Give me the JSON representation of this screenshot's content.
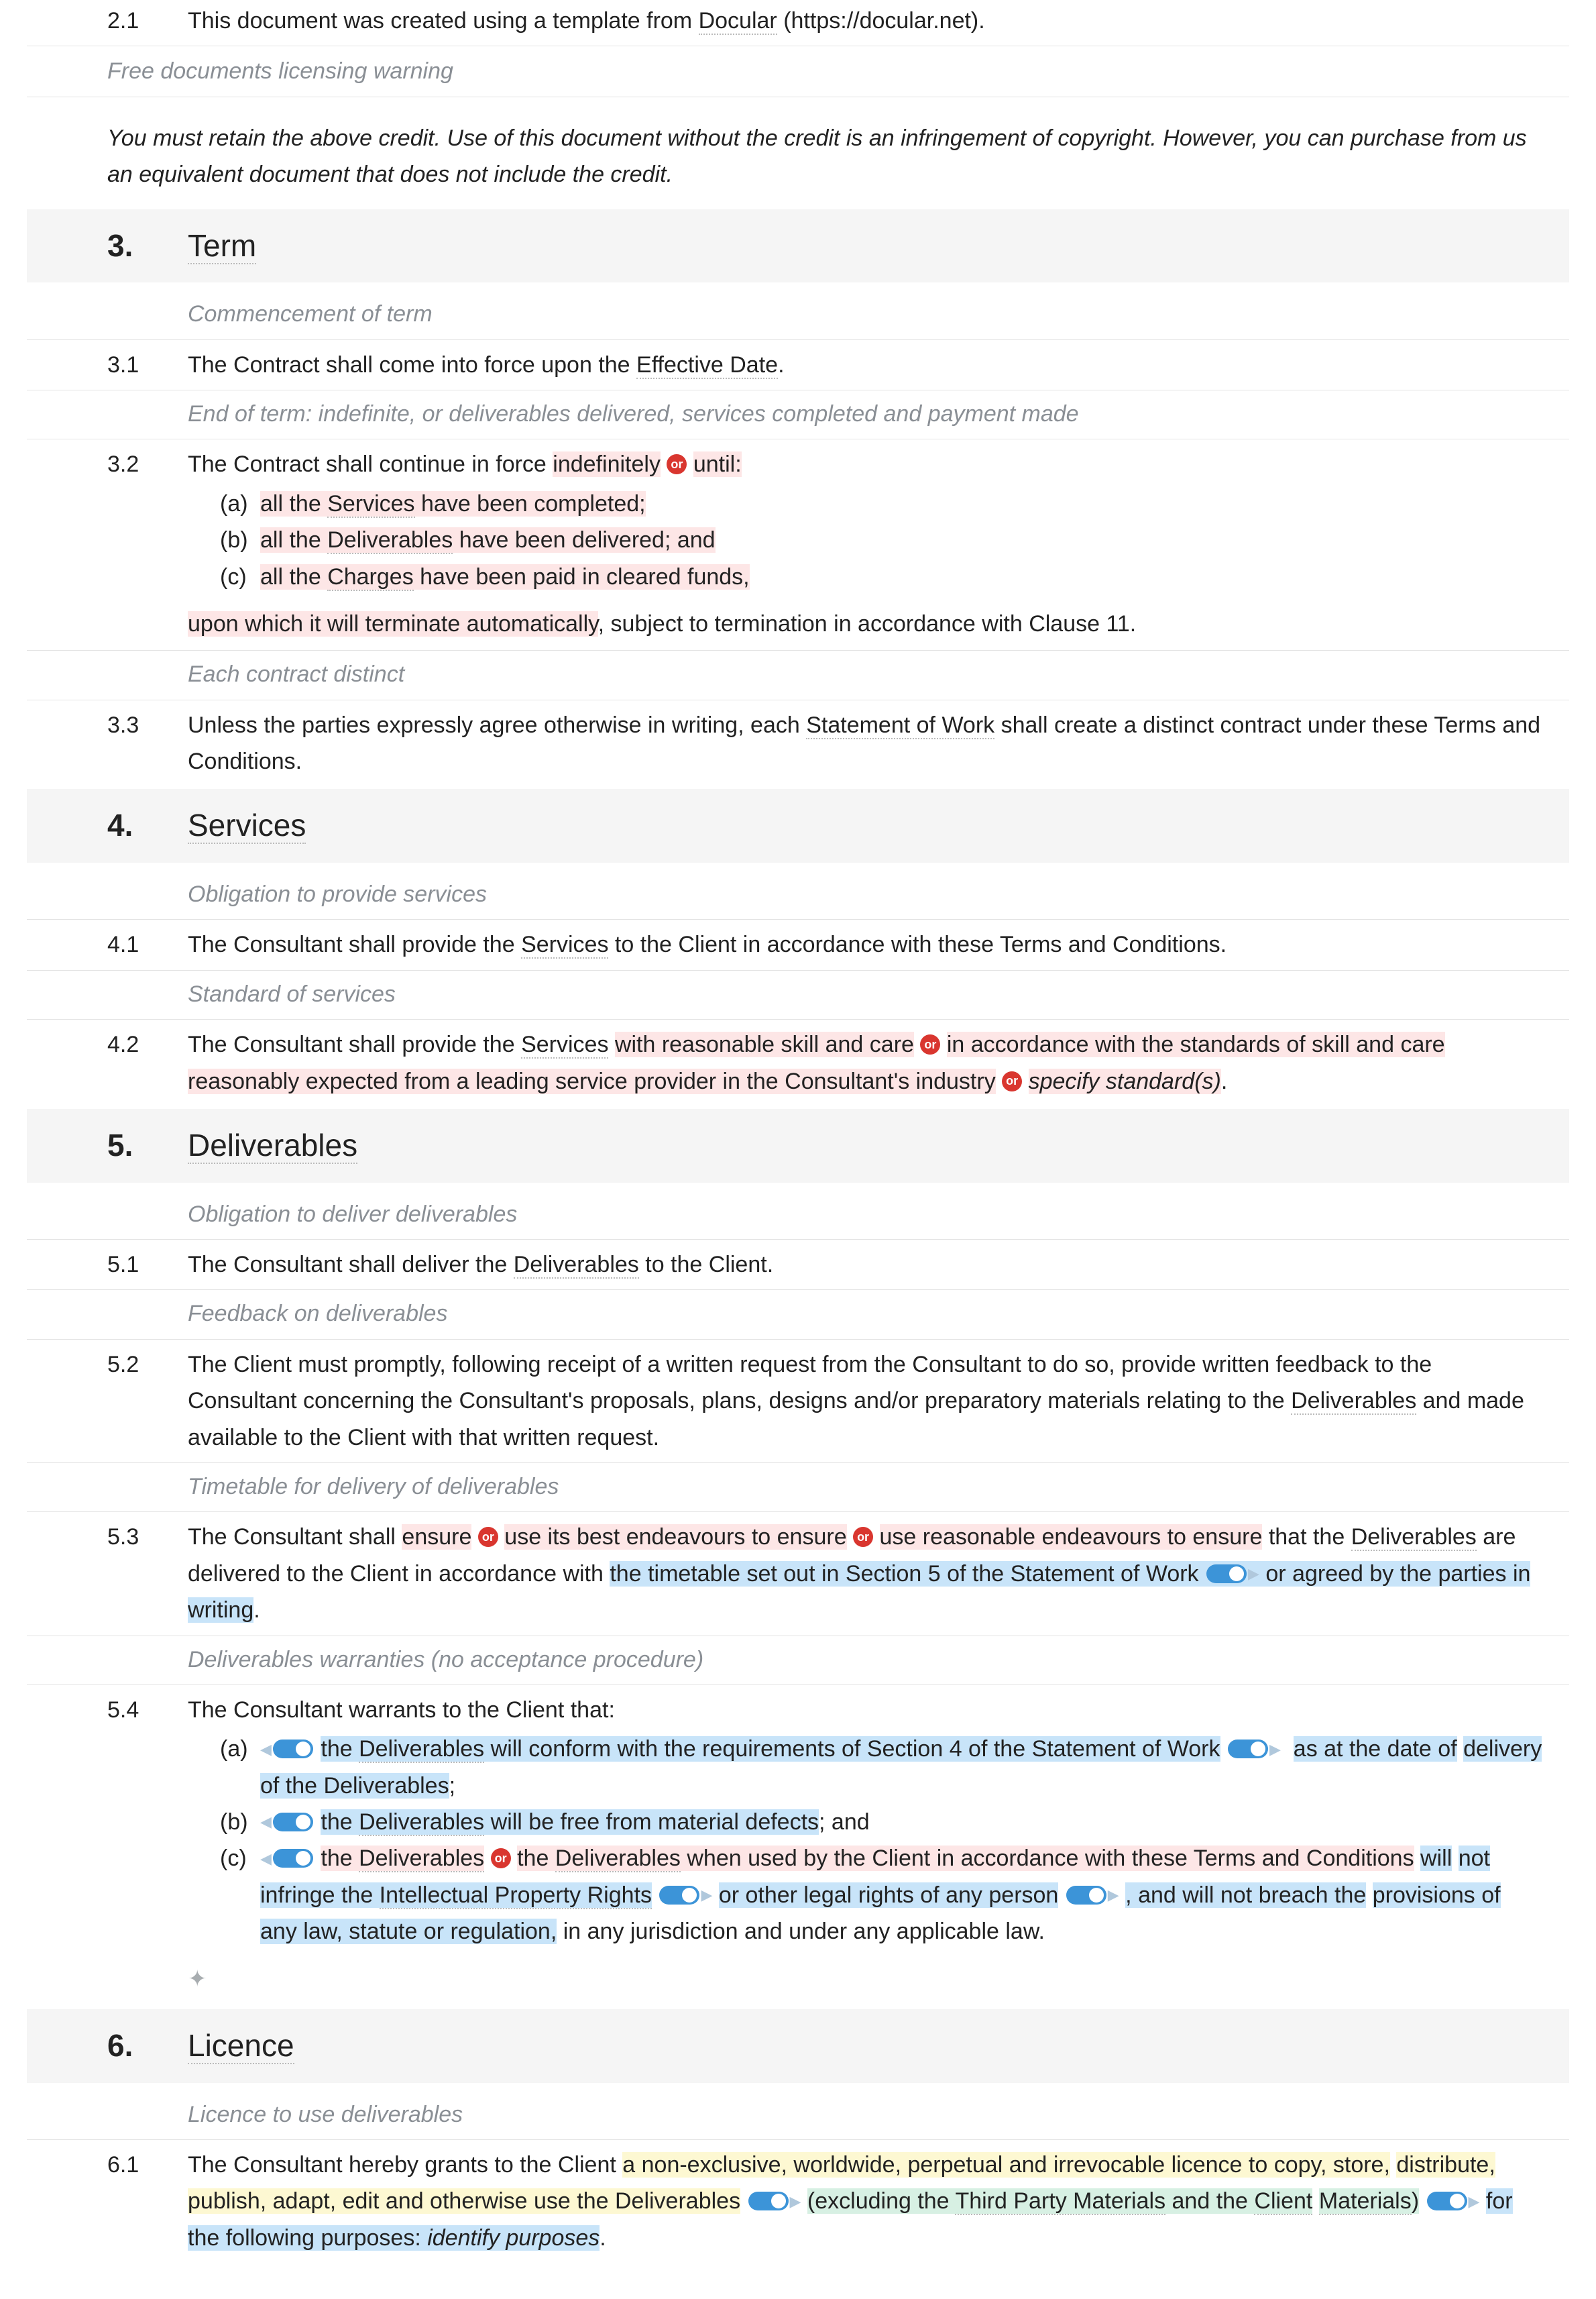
{
  "clause_2_1": {
    "num": "2.1",
    "text_before": "This document was created using a template from ",
    "dotted": "Docular",
    "text_after": " (https://docular.net)."
  },
  "warning_heading": "Free documents licensing warning",
  "warning_text": "You must retain the above credit. Use of this document without the credit is an infringement of copyright. However, you can purchase from us an equivalent document that does not include the credit.",
  "section3": {
    "num": "3.",
    "title": "Term"
  },
  "note_commencement": "Commencement of term",
  "clause_3_1": {
    "num": "3.1",
    "pre": "The Contract shall come into force upon the ",
    "dotted": "Effective Date",
    "post": "."
  },
  "note_end_of_term": "End of term: indefinite, or deliverables delivered, services completed and payment made",
  "clause_3_2": {
    "num": "3.2",
    "intro_a": "The Contract shall continue in force ",
    "hl1": "indefinitely",
    "or": "or",
    "hl2": "until:",
    "a_mark": "(a)",
    "a_pre": "all the ",
    "a_dot": "Services",
    "a_post": " have been completed;",
    "b_mark": "(b)",
    "b_pre": "all the ",
    "b_dot": "Deliverables",
    "b_post": " have been delivered; and",
    "c_mark": "(c)",
    "c_pre": "all the ",
    "c_dot": "Charges",
    "c_post": " have been paid in cleared funds,",
    "tail_hl": "upon which it will terminate automatically",
    "tail_rest": ", subject to termination in accordance with Clause 11."
  },
  "note_each_distinct": "Each contract distinct",
  "clause_3_3": {
    "num": "3.3",
    "pre": "Unless the parties expressly agree otherwise in writing, each ",
    "dotted": "Statement of Work",
    "post": " shall create a distinct contract under these Terms and Conditions."
  },
  "section4": {
    "num": "4.",
    "title": "Services"
  },
  "note_oblig_services": "Obligation to provide services",
  "clause_4_1": {
    "num": "4.1",
    "pre": "The Consultant shall provide the ",
    "dotted": "Services",
    "post": " to the Client in accordance with these Terms and Conditions."
  },
  "note_standard": "Standard of services",
  "clause_4_2": {
    "num": "4.2",
    "a": "The Consultant shall provide the ",
    "dot": "Services",
    "sp": " ",
    "hl1": "with reasonable skill and care",
    "hl2": "in accordance with the standards of skill and care reasonably expected from a leading service provider in the Consultant's industry",
    "hl3": "specify standard(s)",
    "period": "."
  },
  "section5": {
    "num": "5.",
    "title": "Deliverables"
  },
  "note_oblig_deliver": "Obligation to deliver deliverables",
  "clause_5_1": {
    "num": "5.1",
    "pre": "The Consultant shall deliver the ",
    "dotted": "Deliverables",
    "post": " to the Client."
  },
  "note_feedback": "Feedback on deliverables",
  "clause_5_2": {
    "num": "5.2",
    "pre": "The Client must promptly, following receipt of a written request from the Consultant to do so, provide written feedback to the Consultant concerning the Consultant's proposals, plans, designs and/or preparatory materials relating to the ",
    "dotted": "Deliverables",
    "post": " and made available to the Client with that written request."
  },
  "note_timetable": "Timetable for delivery of deliverables",
  "clause_5_3": {
    "num": "5.3",
    "a": "The Consultant shall ",
    "hl1": "ensure",
    "hl2": "use its best endeavours to ensure",
    "hl3": "use reasonable endeavours to ensure",
    "b": " that the ",
    "dot": "Deliverables",
    "c": " are delivered to the Client in accordance with ",
    "bl1": "the timetable set out in Section 5 of the Statement of Work",
    "bl2a": "or",
    "bl2b": "agreed by the parties in writing",
    "period": "."
  },
  "note_warranties": "Deliverables warranties (no acceptance procedure)",
  "clause_5_4": {
    "num": "5.4",
    "intro": "The Consultant warrants to the Client that:",
    "a_mark": "(a)",
    "a_pre": "the ",
    "a_dot": "Deliverables",
    "a_mid": " will conform with the requirements of Section 4 of the Statement of Work",
    "a_tail_pre": "as at the date of",
    "a_tail_rest": "delivery of the Deliverables",
    "a_semi": ";",
    "b_mark": "(b)",
    "b_pre": "the ",
    "b_dot": "Deliverables",
    "b_post": " will be free from material defects",
    "b_after": "; and",
    "c_mark": "(c)",
    "c_hl1_pre": "the ",
    "c_hl1_dot": "Deliverables",
    "c_hl2_pre": "the ",
    "c_hl2_dot": "Deliverables",
    "c_hl2_post": " when used by the Client in accordance with these Terms and Conditions",
    "c_mid1_pre": "will",
    "c_mid1_rest": "not infringe the ",
    "c_mid1_dot": "Intellectual Property Rights",
    "c_tg1": "or other legal rights",
    "c_mid2": " of any person",
    "c_tg2_pre": ", and will not breach the",
    "c_tg2_rest": "provisions of any law, statute or regulation,",
    "c_tail": " in any jurisdiction and under any applicable law."
  },
  "section6": {
    "num": "6.",
    "title": "Licence"
  },
  "note_licence": "Licence to use deliverables",
  "clause_6_1": {
    "num": "6.1",
    "a": "The Consultant hereby grants to the Client ",
    "yl": "a non-exclusive, worldwide, perpetual and irrevocable licence to copy, store,",
    "yl2": "distribute, publish, adapt, edit and otherwise use the Deliverables",
    "gr_pre": "(excluding the ",
    "gr_dot1": "Third Party Materials",
    "gr_mid": " and the ",
    "gr_dot2": "Client",
    "gr_line2": "Materials",
    "gr_close": ")",
    "bl": "for the following purposes: ",
    "it": "identify purposes",
    "period": "."
  },
  "or_label": "or"
}
